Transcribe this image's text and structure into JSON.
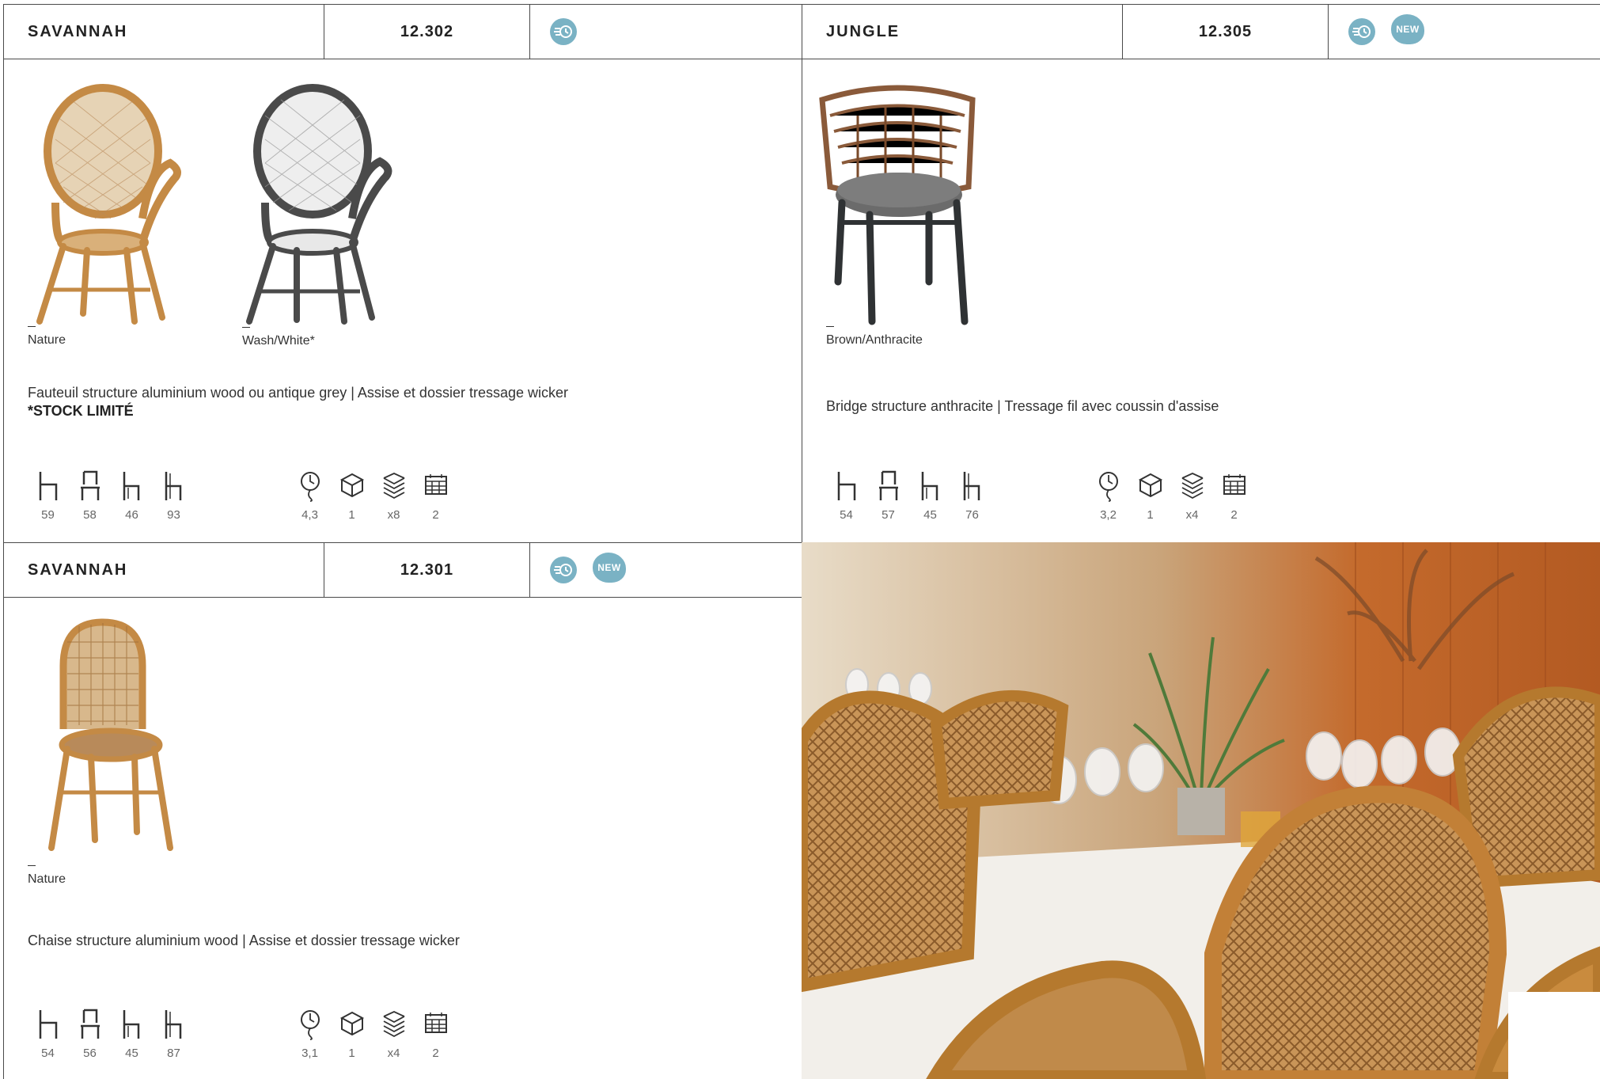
{
  "cards": [
    {
      "name": "SAVANNAH",
      "ref": "12.302",
      "badges": [
        "fast-delivery-icon"
      ],
      "variants": [
        "Nature",
        "Wash/White*"
      ],
      "description": "Fauteuil structure aluminium wood ou antique grey | Assise et dossier tressage wicker",
      "note": "*STOCK LIMITÉ",
      "dimensions": [
        "59",
        "58",
        "46",
        "93"
      ],
      "logistics": [
        "4,3",
        "1",
        "x8",
        "2"
      ]
    },
    {
      "name": "JUNGLE",
      "ref": "12.305",
      "badges": [
        "fast-delivery-icon",
        "new-badge"
      ],
      "variants": [
        "Brown/Anthracite"
      ],
      "description": "Bridge structure anthracite | Tressage fil avec coussin d'assise",
      "dimensions": [
        "54",
        "57",
        "45",
        "76"
      ],
      "logistics": [
        "3,2",
        "1",
        "x4",
        "2"
      ]
    },
    {
      "name": "SAVANNAH",
      "ref": "12.301",
      "badges": [
        "fast-delivery-icon",
        "new-badge"
      ],
      "variants": [
        "Nature"
      ],
      "description": "Chaise structure aluminium wood |  Assise et dossier tressage wicker",
      "dimensions": [
        "54",
        "56",
        "45",
        "87"
      ],
      "logistics": [
        "3,1",
        "1",
        "x4",
        "2"
      ]
    }
  ],
  "new_label": "NEW",
  "colors": {
    "badge": "#7ab2c4",
    "rattan": "#c48a45",
    "anthracite": "#3a3d40",
    "wood_wall": "#c46a2c"
  }
}
